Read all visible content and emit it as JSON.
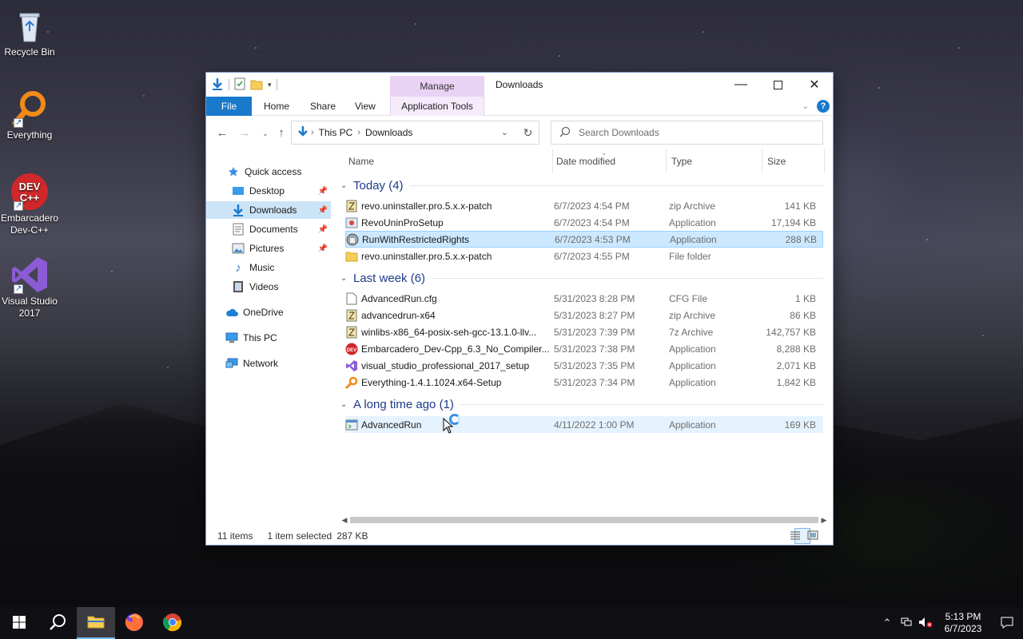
{
  "desktop": {
    "icons": [
      {
        "label": "Recycle Bin"
      },
      {
        "label": "Everything"
      },
      {
        "label": "Embarcadero Dev-C++"
      },
      {
        "label": "Visual Studio 2017"
      }
    ]
  },
  "window": {
    "title": "Downloads",
    "manage_tab": "Manage",
    "ribbon_tabs": {
      "file": "File",
      "home": "Home",
      "share": "Share",
      "view": "View",
      "app_tools": "Application Tools"
    },
    "address": {
      "root": "This PC",
      "current": "Downloads"
    },
    "search": {
      "placeholder": "Search Downloads"
    },
    "nav": {
      "quick_access": "Quick access",
      "desktop": "Desktop",
      "downloads": "Downloads",
      "documents": "Documents",
      "pictures": "Pictures",
      "music": "Music",
      "videos": "Videos",
      "onedrive": "OneDrive",
      "this_pc": "This PC",
      "network": "Network"
    },
    "columns": {
      "name": "Name",
      "date": "Date modified",
      "type": "Type",
      "size": "Size"
    },
    "groups": {
      "today": {
        "title": "Today (4)",
        "files": [
          {
            "name": "revo.uninstaller.pro.5.x.x-patch",
            "date": "6/7/2023 4:54 PM",
            "type": "zip Archive",
            "size": "141 KB"
          },
          {
            "name": "RevoUninProSetup",
            "date": "6/7/2023 4:54 PM",
            "type": "Application",
            "size": "17,194 KB"
          },
          {
            "name": "RunWithRestrictedRights",
            "date": "6/7/2023 4:53 PM",
            "type": "Application",
            "size": "288 KB"
          },
          {
            "name": "revo.uninstaller.pro.5.x.x-patch",
            "date": "6/7/2023 4:55 PM",
            "type": "File folder",
            "size": ""
          }
        ]
      },
      "last_week": {
        "title": "Last week (6)",
        "files": [
          {
            "name": "AdvancedRun.cfg",
            "date": "5/31/2023 8:28 PM",
            "type": "CFG File",
            "size": "1 KB"
          },
          {
            "name": "advancedrun-x64",
            "date": "5/31/2023 8:27 PM",
            "type": "zip Archive",
            "size": "86 KB"
          },
          {
            "name": "winlibs-x86_64-posix-seh-gcc-13.1.0-llv...",
            "date": "5/31/2023 7:39 PM",
            "type": "7z Archive",
            "size": "142,757 KB"
          },
          {
            "name": "Embarcadero_Dev-Cpp_6.3_No_Compiler...",
            "date": "5/31/2023 7:38 PM",
            "type": "Application",
            "size": "8,288 KB"
          },
          {
            "name": "visual_studio_professional_2017_setup",
            "date": "5/31/2023 7:35 PM",
            "type": "Application",
            "size": "2,071 KB"
          },
          {
            "name": "Everything-1.4.1.1024.x64-Setup",
            "date": "5/31/2023 7:34 PM",
            "type": "Application",
            "size": "1,842 KB"
          }
        ]
      },
      "long_ago": {
        "title": "A long time ago (1)",
        "files": [
          {
            "name": "AdvancedRun",
            "date": "4/11/2022 1:00 PM",
            "type": "Application",
            "size": "169 KB"
          }
        ]
      }
    },
    "status": {
      "items": "11 items",
      "selected": "1 item selected",
      "size": "287 KB"
    }
  },
  "taskbar": {
    "time": "5:13 PM",
    "date": "6/7/2023"
  },
  "colors": {
    "accent": "#1979ca",
    "selection": "#cce8ff",
    "manage": "#e9d3f5"
  }
}
